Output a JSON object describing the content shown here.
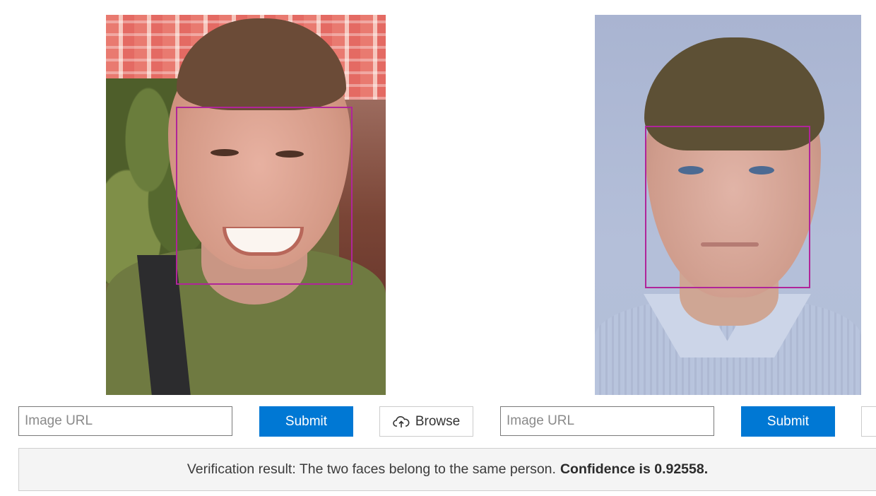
{
  "left_panel": {
    "url_placeholder": "Image URL",
    "submit_label": "Submit",
    "browse_label": "Browse",
    "browse_icon": "cloud-upload-icon"
  },
  "right_panel": {
    "url_placeholder": "Image URL",
    "submit_label": "Submit"
  },
  "result": {
    "text": "Verification result: The two faces belong to the same person.",
    "confidence_text": "Confidence is 0.92558."
  },
  "colors": {
    "face_box": "#b0259a",
    "submit_bg": "#0078d4",
    "result_bg": "#f4f4f4"
  }
}
